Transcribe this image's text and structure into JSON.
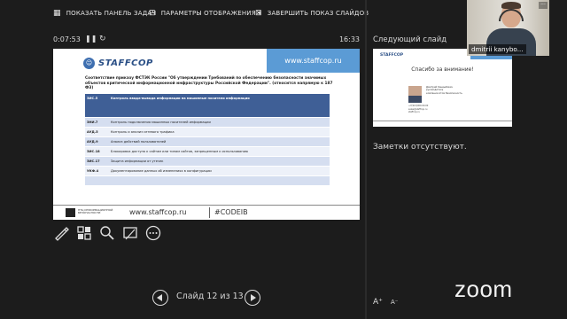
{
  "toolbar": {
    "show_taskbar": "ПОКАЗАТЬ ПАНЕЛЬ ЗАДАЧ",
    "display_settings": "ПАРАМЕТРЫ ОТОБРАЖЕНИЯ ▾",
    "end_show": "ЗАВЕРШИТЬ ПОКАЗ СЛАЙДОВ"
  },
  "timer": {
    "elapsed": "0:07:53",
    "clock": "16:33"
  },
  "slide": {
    "logo": "STAFFCOP",
    "url_box": "www.staffcop.ru",
    "heading": "Соответствие приказу ФСТЭК России \"Об утверждении Требований по обеспечению безопасности значимых объектов критической информационной инфраструктуры Российской Федерации\". (относится напрямую к 187 ФЗ)",
    "rows": [
      {
        "code": "ЗИС.5",
        "text": "Контроль ввода-вывода информации на машинные носители информации"
      },
      {
        "code": "ЗНИ.7",
        "text": "Контроль подключения машинных носителей информации"
      },
      {
        "code": "АУД.5",
        "text": "Контроль и анализ сетевого трафика"
      },
      {
        "code": "АУД.9",
        "text": "Анализ действий пользователей"
      },
      {
        "code": "ЗИС.18",
        "text": "Блокировка доступа к сайтам или типам сайтов, запрещенным к использованию"
      },
      {
        "code": "ЗИС.17",
        "text": "Защита информации от утечек"
      },
      {
        "code": "УКФ.4",
        "text": "Документирование данных об изменениях в конфигурации"
      }
    ],
    "footer_logo_text": "НТЦ ИНФОРМАЦИОННОЙ БЕЗОПАСНОСТИ",
    "footer_url": "www.staffcop.ru",
    "footer_tag": "#CODEIB"
  },
  "navigation": {
    "label": "Слайд 12 из 13"
  },
  "sidebar": {
    "next_slide_label": "Следующий слайд",
    "notes": "Заметки отсутствуют."
  },
  "next_slide": {
    "logo": "STAFFCOP",
    "url": "www.staffcop.ru",
    "thanks": "Спасибо за внимание!",
    "name": "Дмитрий Кандыбович",
    "role": "руководитель",
    "company": "компании Атом Безопасность",
    "contacts": "+7(913)000-00-00\nsales@staffcop.ru\nstaffcop.ru"
  },
  "video": {
    "participant_name": "dmitrii kanybo..."
  },
  "zoom": {
    "logo": "zoom"
  },
  "font_controls": {
    "increase": "A⁺",
    "decrease": "A⁻"
  },
  "icons": [
    "taskbar-icon",
    "display-settings-icon",
    "end-show-icon",
    "pause-icon",
    "restart-icon",
    "pen-icon",
    "slides-grid-icon",
    "zoom-in-icon",
    "laser-pointer-icon",
    "more-options-icon",
    "prev-arrow-icon",
    "next-arrow-icon"
  ]
}
